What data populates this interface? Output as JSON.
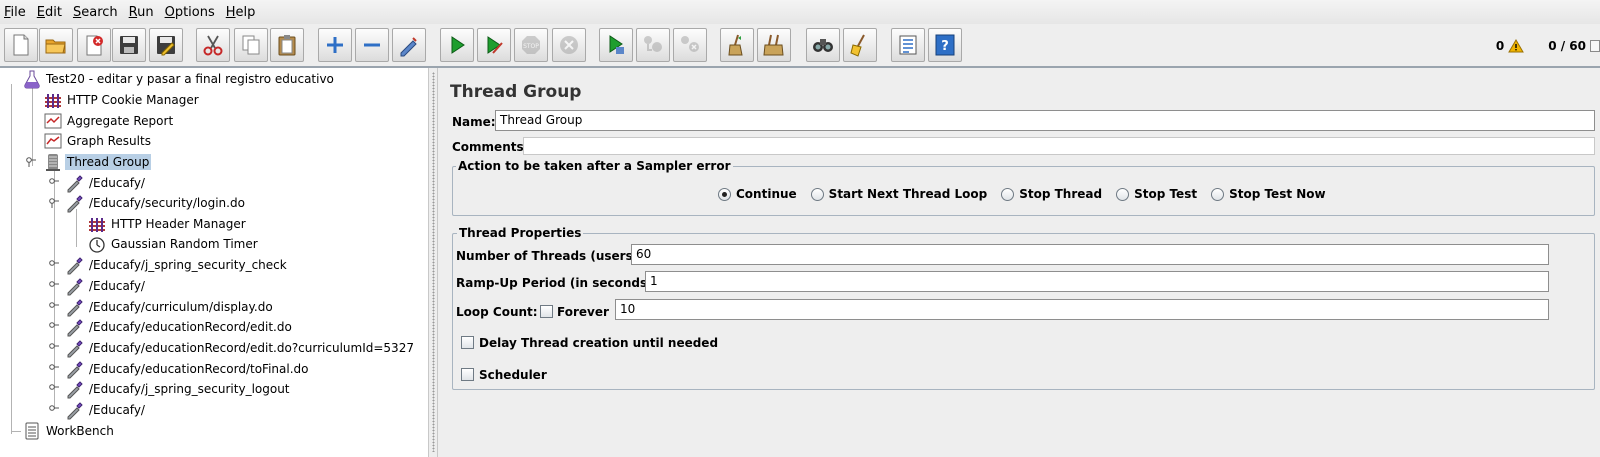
{
  "menu": [
    {
      "mnemonic": "F",
      "rest": "ile"
    },
    {
      "mnemonic": "E",
      "rest": "dit"
    },
    {
      "mnemonic": "S",
      "rest": "earch"
    },
    {
      "mnemonic": "R",
      "rest": "un"
    },
    {
      "mnemonic": "O",
      "rest": "ptions"
    },
    {
      "mnemonic": "H",
      "rest": "elp"
    }
  ],
  "toolbar": {
    "buttons": [
      "new-icon",
      "open-icon",
      "close-icon",
      "save-icon",
      "save-as-icon",
      "cut-icon",
      "copy-icon",
      "paste-icon",
      "expand-icon",
      "collapse-icon",
      "toggle-icon",
      "start-icon",
      "start-no-pause-icon",
      "stop-icon",
      "shutdown-icon",
      "remote-start-icon",
      "remote-stop-icon",
      "remote-shutdown-icon",
      "clear-icon",
      "clear-all-icon",
      "search-icon",
      "reset-search-icon",
      "function-helper-icon",
      "help-icon"
    ],
    "colors": {
      "accent_blue": "#2e6fc6",
      "run_green": "#1e9e2e",
      "warning": "#f0b400"
    }
  },
  "status": {
    "warnings": "0",
    "threads": "0 / 60"
  },
  "tree": {
    "nodes": [
      {
        "label": "Test20 - editar y pasar a final registro educativo",
        "icon": "test-plan-icon"
      },
      {
        "label": "HTTP Cookie Manager",
        "icon": "cookie-manager-icon"
      },
      {
        "label": "Aggregate Report",
        "icon": "report-icon"
      },
      {
        "label": "Graph Results",
        "icon": "graph-icon"
      },
      {
        "label": "Thread Group",
        "icon": "thread-group-icon"
      },
      {
        "label": "/Educafy/",
        "icon": "sampler-pipette-icon"
      },
      {
        "label": "/Educafy/security/login.do",
        "icon": "sampler-pipette-icon"
      },
      {
        "label": "HTTP Header Manager",
        "icon": "header-manager-icon"
      },
      {
        "label": "Gaussian Random Timer",
        "icon": "timer-icon"
      },
      {
        "label": "/Educafy/j_spring_security_check",
        "icon": "sampler-pipette-icon"
      },
      {
        "label": "/Educafy/",
        "icon": "sampler-pipette-icon"
      },
      {
        "label": "/Educafy/curriculum/display.do",
        "icon": "sampler-pipette-icon"
      },
      {
        "label": "/Educafy/educationRecord/edit.do",
        "icon": "sampler-pipette-icon"
      },
      {
        "label": "/Educafy/educationRecord/edit.do?curriculumId=5327",
        "icon": "sampler-pipette-icon"
      },
      {
        "label": "/Educafy/educationRecord/toFinal.do",
        "icon": "sampler-pipette-icon"
      },
      {
        "label": "/Educafy/j_spring_security_logout",
        "icon": "sampler-pipette-icon"
      },
      {
        "label": "/Educafy/",
        "icon": "sampler-pipette-icon"
      },
      {
        "label": "WorkBench",
        "icon": "workbench-icon"
      }
    ]
  },
  "panel": {
    "title": "Thread Group",
    "name_label": "Name:",
    "name_value": "Thread Group",
    "comments_label": "Comments:",
    "comments_value": "",
    "error_action": {
      "title": "Action to be taken after a Sampler error",
      "options": [
        "Continue",
        "Start Next Thread Loop",
        "Stop Thread",
        "Stop Test",
        "Stop Test Now"
      ],
      "selected": "Continue"
    },
    "thread_props": {
      "title": "Thread Properties",
      "threads_label": "Number of Threads (users):",
      "threads_value": "60",
      "rampup_label": "Ramp-Up Period (in seconds):",
      "rampup_value": "1",
      "loop_label": "Loop Count:",
      "forever_label": "Forever",
      "forever_checked": false,
      "loop_value": "10",
      "delay_label": "Delay Thread creation until needed",
      "delay_checked": false,
      "scheduler_label": "Scheduler",
      "scheduler_checked": false
    }
  }
}
